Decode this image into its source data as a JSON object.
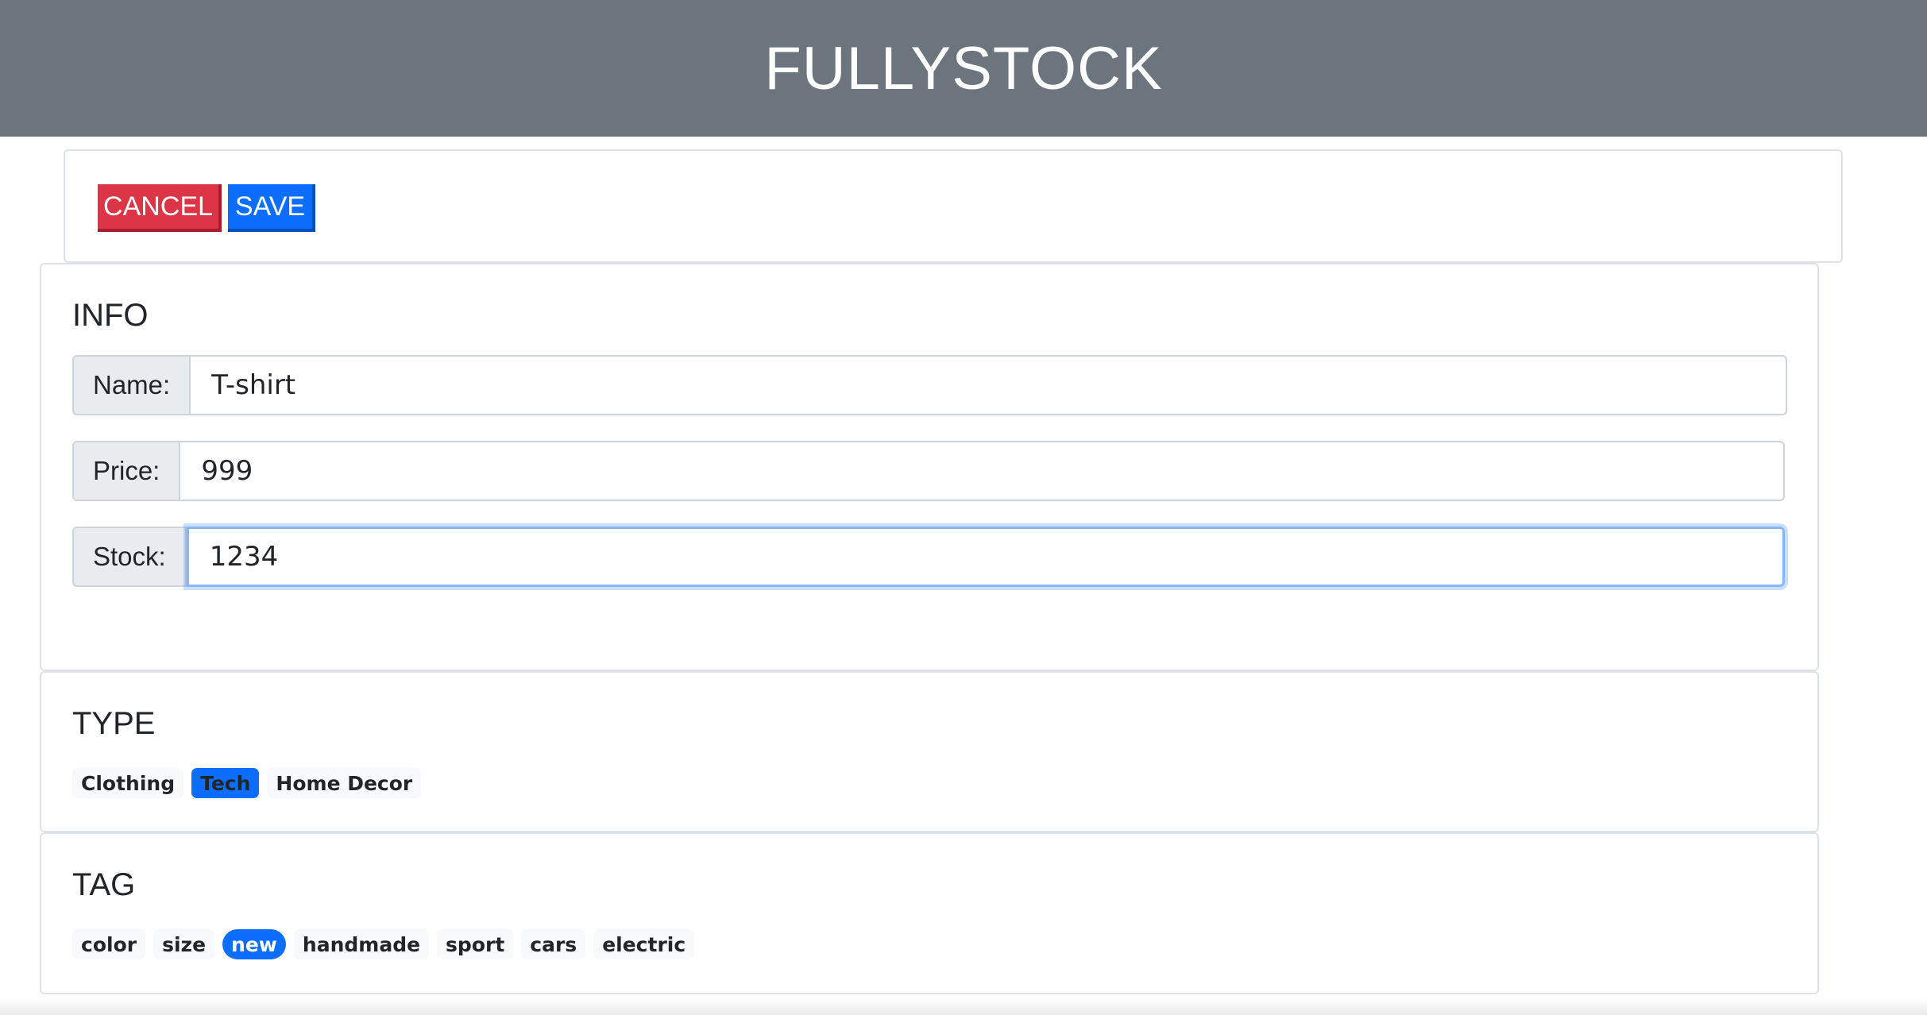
{
  "header": {
    "brand": "FULLYSTOCK"
  },
  "actions": {
    "cancel_label": "CANCEL",
    "save_label": "SAVE"
  },
  "info": {
    "title": "INFO",
    "fields": {
      "name": {
        "label": "Name:",
        "value": "T-shirt"
      },
      "price": {
        "label": "Price:",
        "value": "999"
      },
      "stock": {
        "label": "Stock:",
        "value": "1234"
      }
    }
  },
  "type": {
    "title": "TYPE",
    "options": [
      "Clothing",
      "Tech",
      "Home Decor"
    ],
    "selected": "Tech"
  },
  "tag": {
    "title": "TAG",
    "options": [
      "color",
      "size",
      "new",
      "handmade",
      "sport",
      "cars",
      "electric"
    ],
    "selected": "new"
  },
  "colors": {
    "header_bg": "#6c757d",
    "cancel": "#dc3545",
    "save": "#0d6efd",
    "selected_badge": "#0d6efd"
  }
}
